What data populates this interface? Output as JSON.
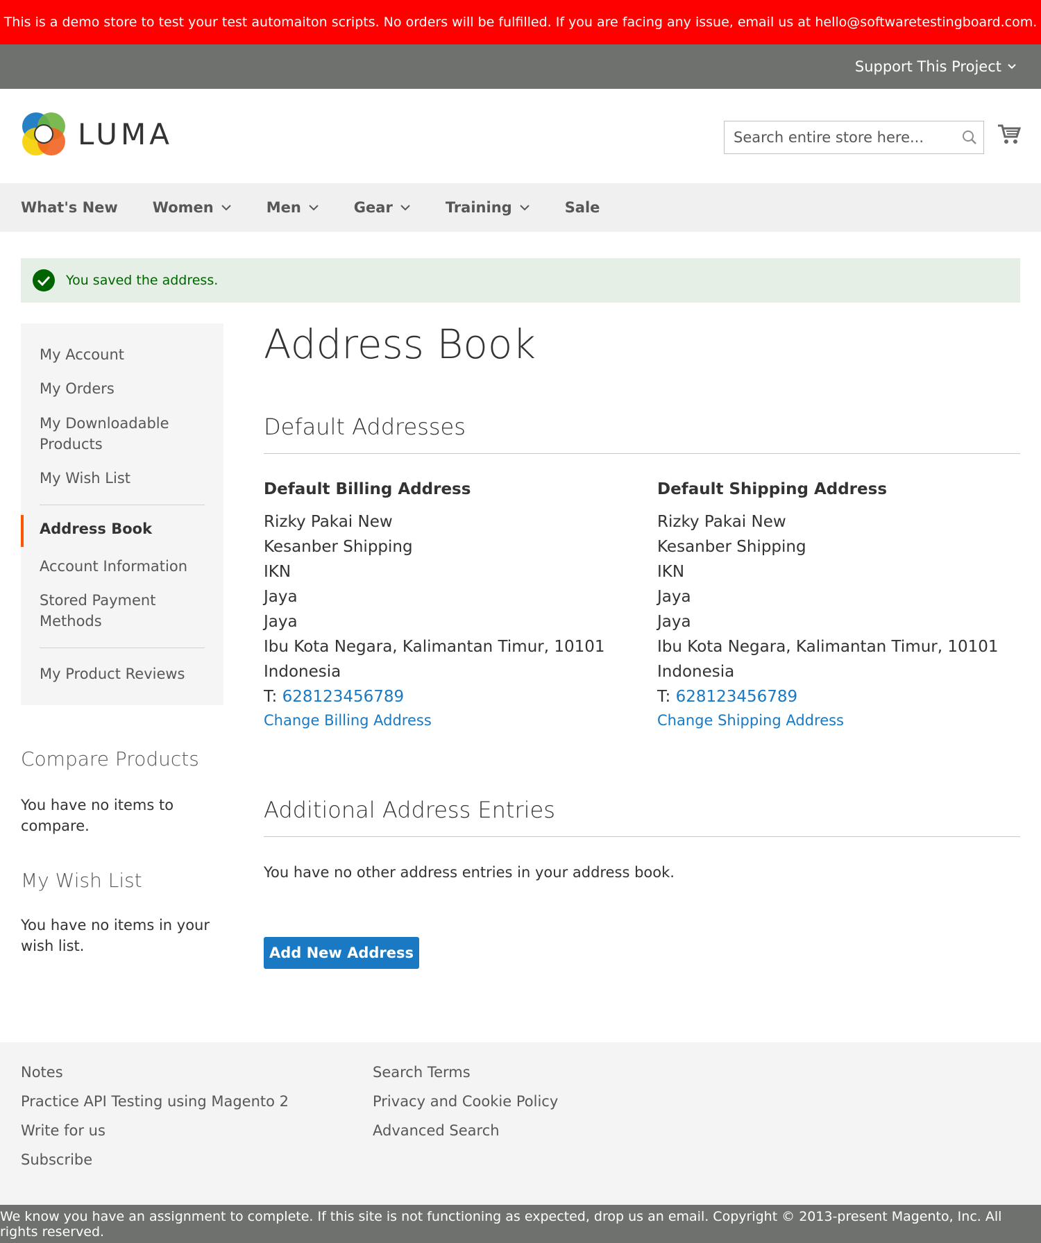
{
  "banner": "This is a demo store to test your test automaiton scripts. No orders will be fulfilled. If you are facing any issue, email us at hello@softwaretestingboard.com.",
  "top_bar": {
    "support": "Support This Project"
  },
  "header": {
    "logo": "LUMA",
    "search_placeholder": "Search entire store here..."
  },
  "nav": {
    "items": [
      "What's New",
      "Women",
      "Men",
      "Gear",
      "Training",
      "Sale"
    ]
  },
  "message": "You saved the address.",
  "sidebar": {
    "links": [
      "My Account",
      "My Orders",
      "My Downloadable Products",
      "My Wish List",
      "Address Book",
      "Account Information",
      "Stored Payment Methods",
      "My Product Reviews"
    ],
    "current": "Address Book"
  },
  "compare": {
    "title": "Compare Products",
    "text": "You have no items to compare."
  },
  "wishlist": {
    "title": "My Wish List",
    "text": "You have no items in your wish list."
  },
  "main": {
    "title": "Address Book",
    "default_title": "Default Addresses",
    "billing": {
      "heading": "Default Billing Address",
      "lines": [
        "Rizky Pakai New",
        "Kesanber Shipping",
        "IKN",
        "Jaya",
        "Jaya",
        "Ibu Kota Negara, Kalimantan Timur, 10101",
        "Indonesia"
      ],
      "phone_label": "T: ",
      "phone": "628123456789",
      "change": "Change Billing Address"
    },
    "shipping": {
      "heading": "Default Shipping Address",
      "lines": [
        "Rizky Pakai New",
        "Kesanber Shipping",
        "IKN",
        "Jaya",
        "Jaya",
        "Ibu Kota Negara, Kalimantan Timur, 10101",
        "Indonesia"
      ],
      "phone_label": "T: ",
      "phone": "628123456789",
      "change": "Change Shipping Address"
    },
    "additional_title": "Additional Address Entries",
    "no_entries": "You have no other address entries in your address book.",
    "add_button": "Add New Address"
  },
  "footer": {
    "col1": [
      "Notes",
      "Practice API Testing using Magento 2",
      "Write for us",
      "Subscribe"
    ],
    "col2": [
      "Search Terms",
      "Privacy and Cookie Policy",
      "Advanced Search"
    ]
  },
  "copyright": "We know you have an assignment to complete. If this site is not functioning as expected, drop us an email. Copyright © 2013-present Magento, Inc. All rights reserved.",
  "colors": {
    "banner": "#ff0000",
    "topbar": "#6e716e",
    "link": "#1979c3",
    "success_text": "#006400",
    "success_bg": "#e5efe5",
    "current_marker": "#ff5501"
  },
  "icons": [
    "chevron-down-icon",
    "luma-logo-icon",
    "search-icon",
    "cart-icon",
    "check-circle-icon"
  ]
}
